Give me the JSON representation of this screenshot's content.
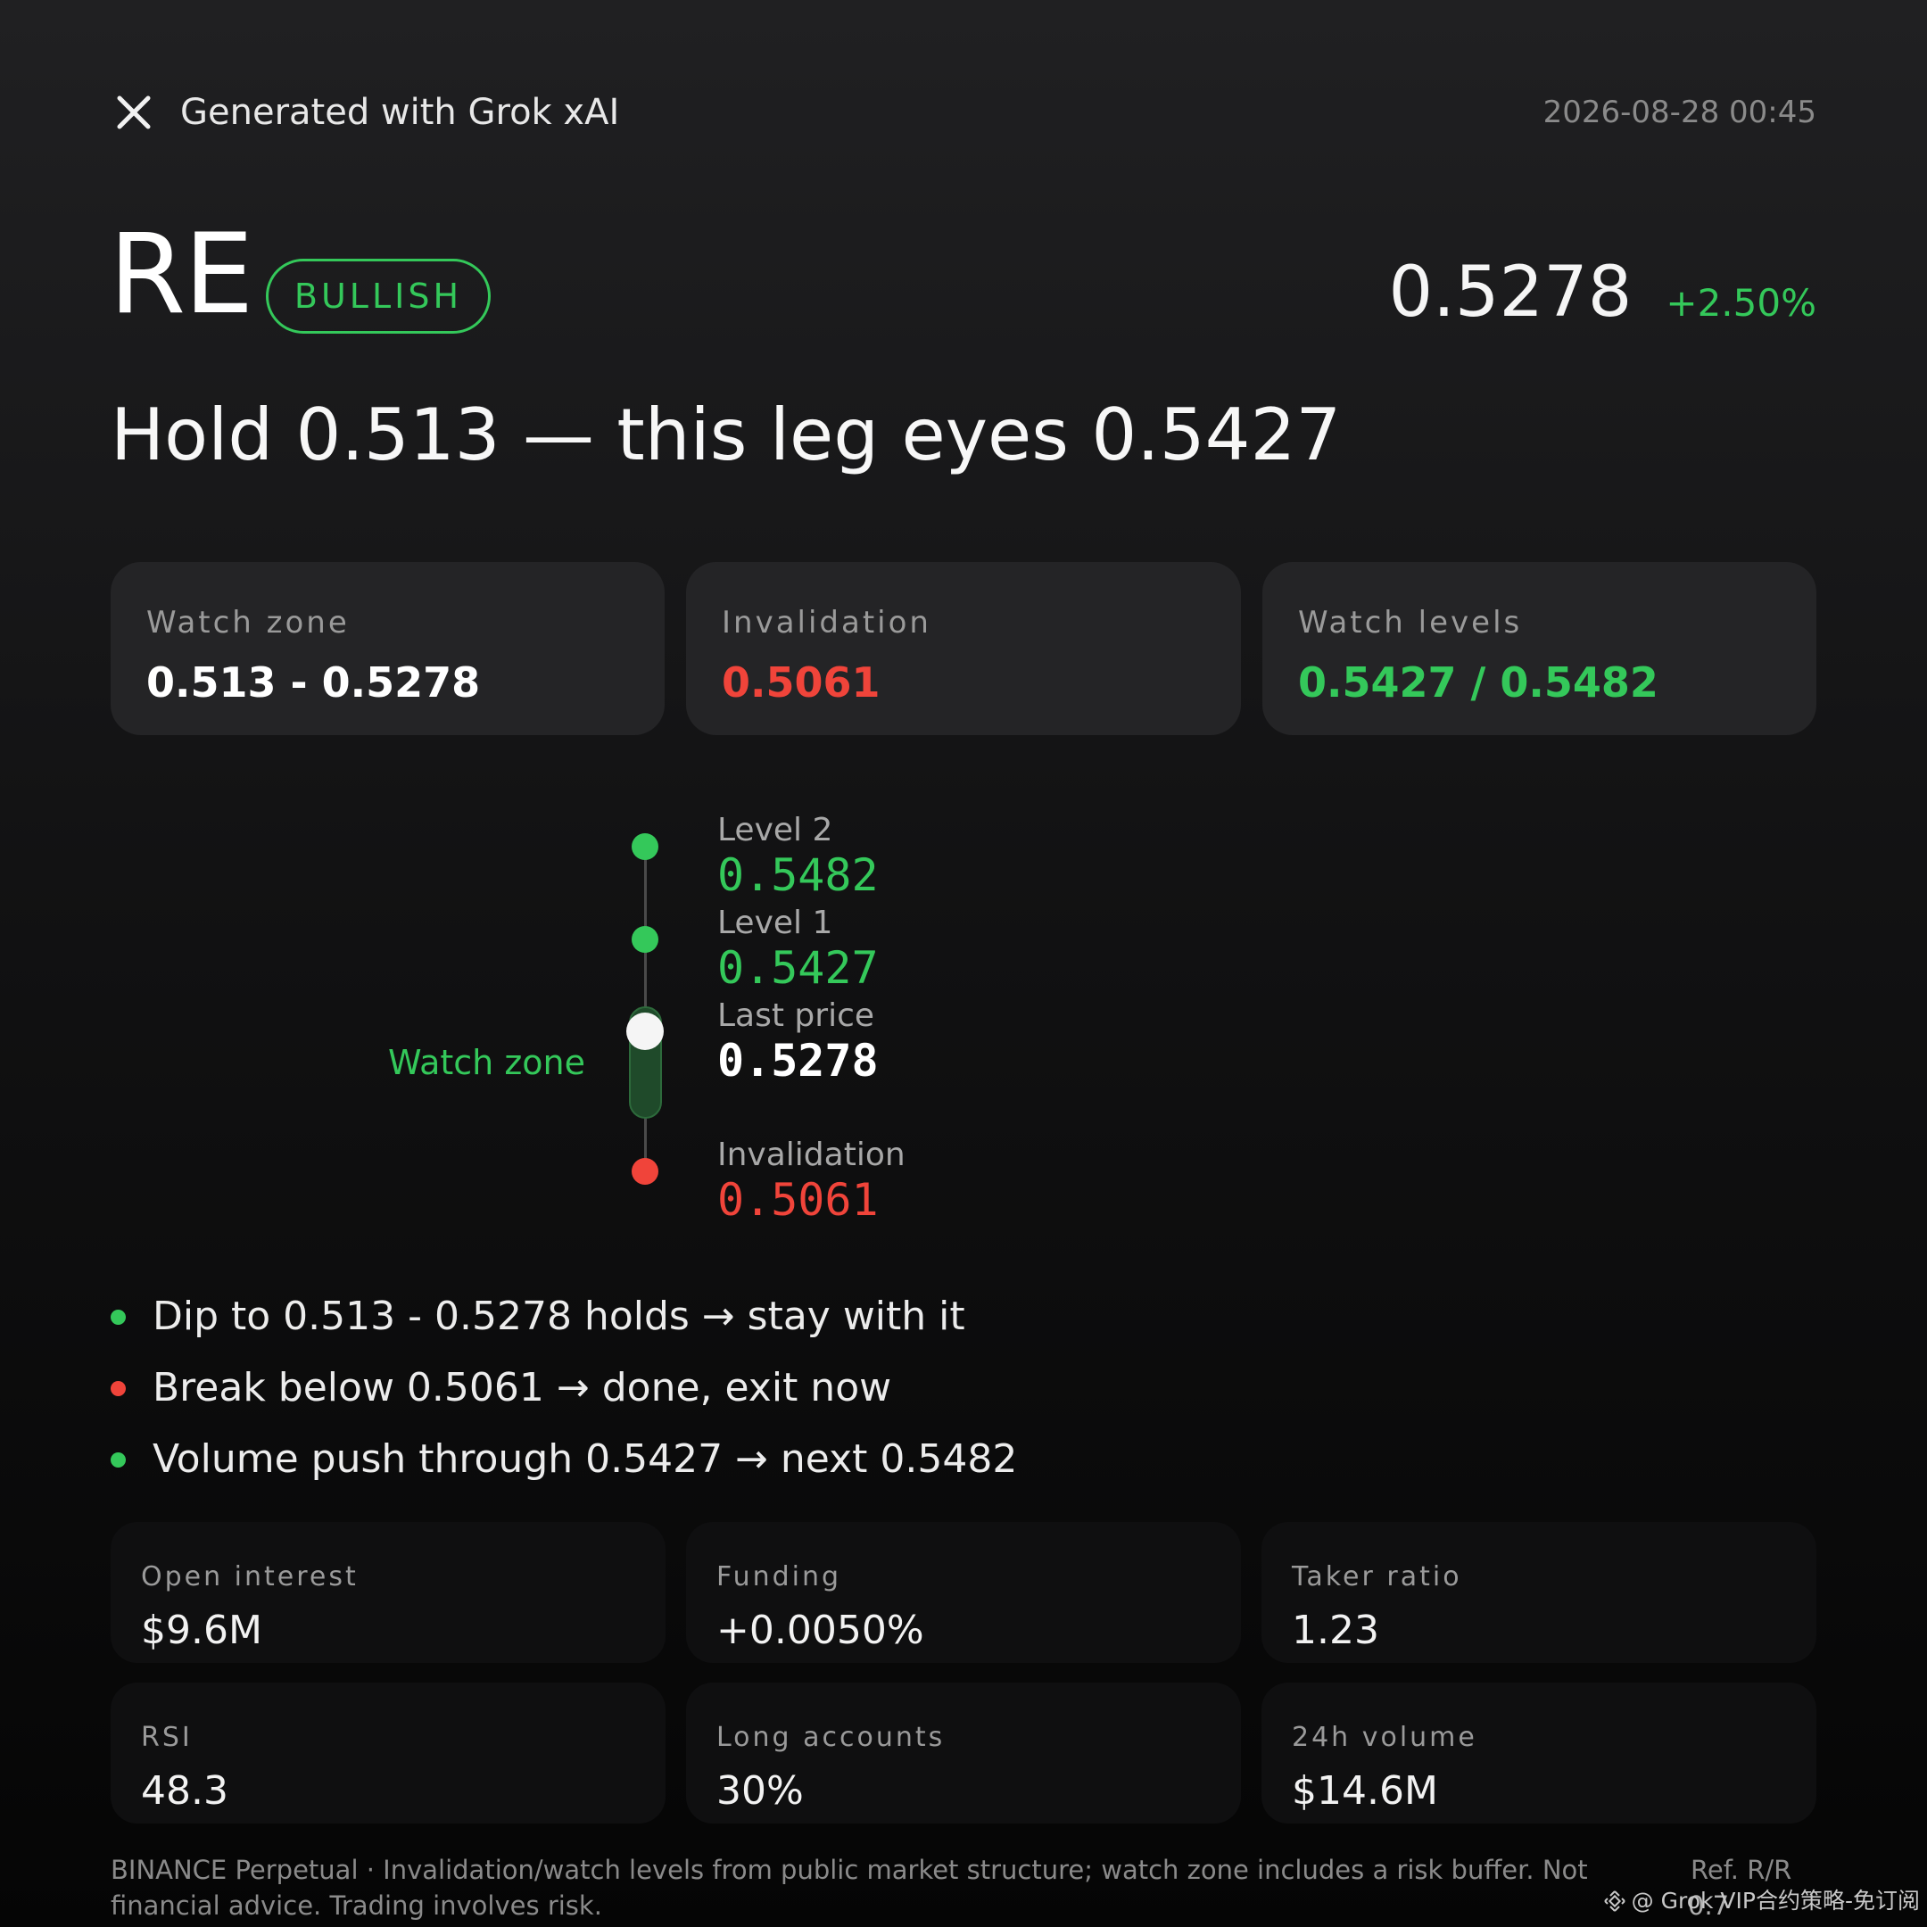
{
  "header": {
    "close_icon": "close-icon",
    "title": "Generated with Grok xAI",
    "timestamp": "2026-08-28 00:45"
  },
  "ticker": {
    "symbol": "RE",
    "sentiment": "BULLISH",
    "last_price": "0.5278",
    "change": "+2.50%"
  },
  "headline": "Hold 0.513 — this leg eyes 0.5427",
  "cards": [
    {
      "label": "Watch zone",
      "value": "0.513 - 0.5278"
    },
    {
      "label": "Invalidation",
      "value": "0.5061"
    },
    {
      "label": "Watch levels",
      "value": "0.5427 / 0.5482"
    }
  ],
  "ladder": {
    "watch_zone_label": "Watch zone",
    "levels": [
      {
        "label": "Level 2",
        "value": "0.5482"
      },
      {
        "label": "Level 1",
        "value": "0.5427"
      },
      {
        "label": "Last price",
        "value": "0.5278"
      },
      {
        "label": "Invalidation",
        "value": "0.5061"
      }
    ]
  },
  "bullets": [
    {
      "text": "Dip to 0.513 - 0.5278 holds → stay with it",
      "status": "green"
    },
    {
      "text": "Break below 0.5061 → done, exit now",
      "status": "red"
    },
    {
      "text": "Volume push through 0.5427 → next 0.5482",
      "status": "green"
    }
  ],
  "stats": [
    {
      "label": "Open interest",
      "value": "$9.6M"
    },
    {
      "label": "Funding",
      "value": "+0.0050%"
    },
    {
      "label": "Taker ratio",
      "value": "1.23"
    },
    {
      "label": "RSI",
      "value": "48.3"
    },
    {
      "label": "Long accounts",
      "value": "30%"
    },
    {
      "label": "24h volume",
      "value": "$14.6M"
    }
  ],
  "footer": {
    "disclaimer": "BINANCE Perpetual · Invalidation/watch levels from public market structure; watch zone includes a risk buffer. Not financial advice. Trading involves risk.",
    "ref_label": "Ref. R/R",
    "ref_value": "0.7",
    "watermark": "@ Grok VIP合约策略-免订阅",
    "watermark_icon": "binance-logo-icon"
  },
  "colors": {
    "bullish": "#34c85a",
    "bearish": "#f0443a",
    "background": "#121213",
    "card": "#242426"
  }
}
